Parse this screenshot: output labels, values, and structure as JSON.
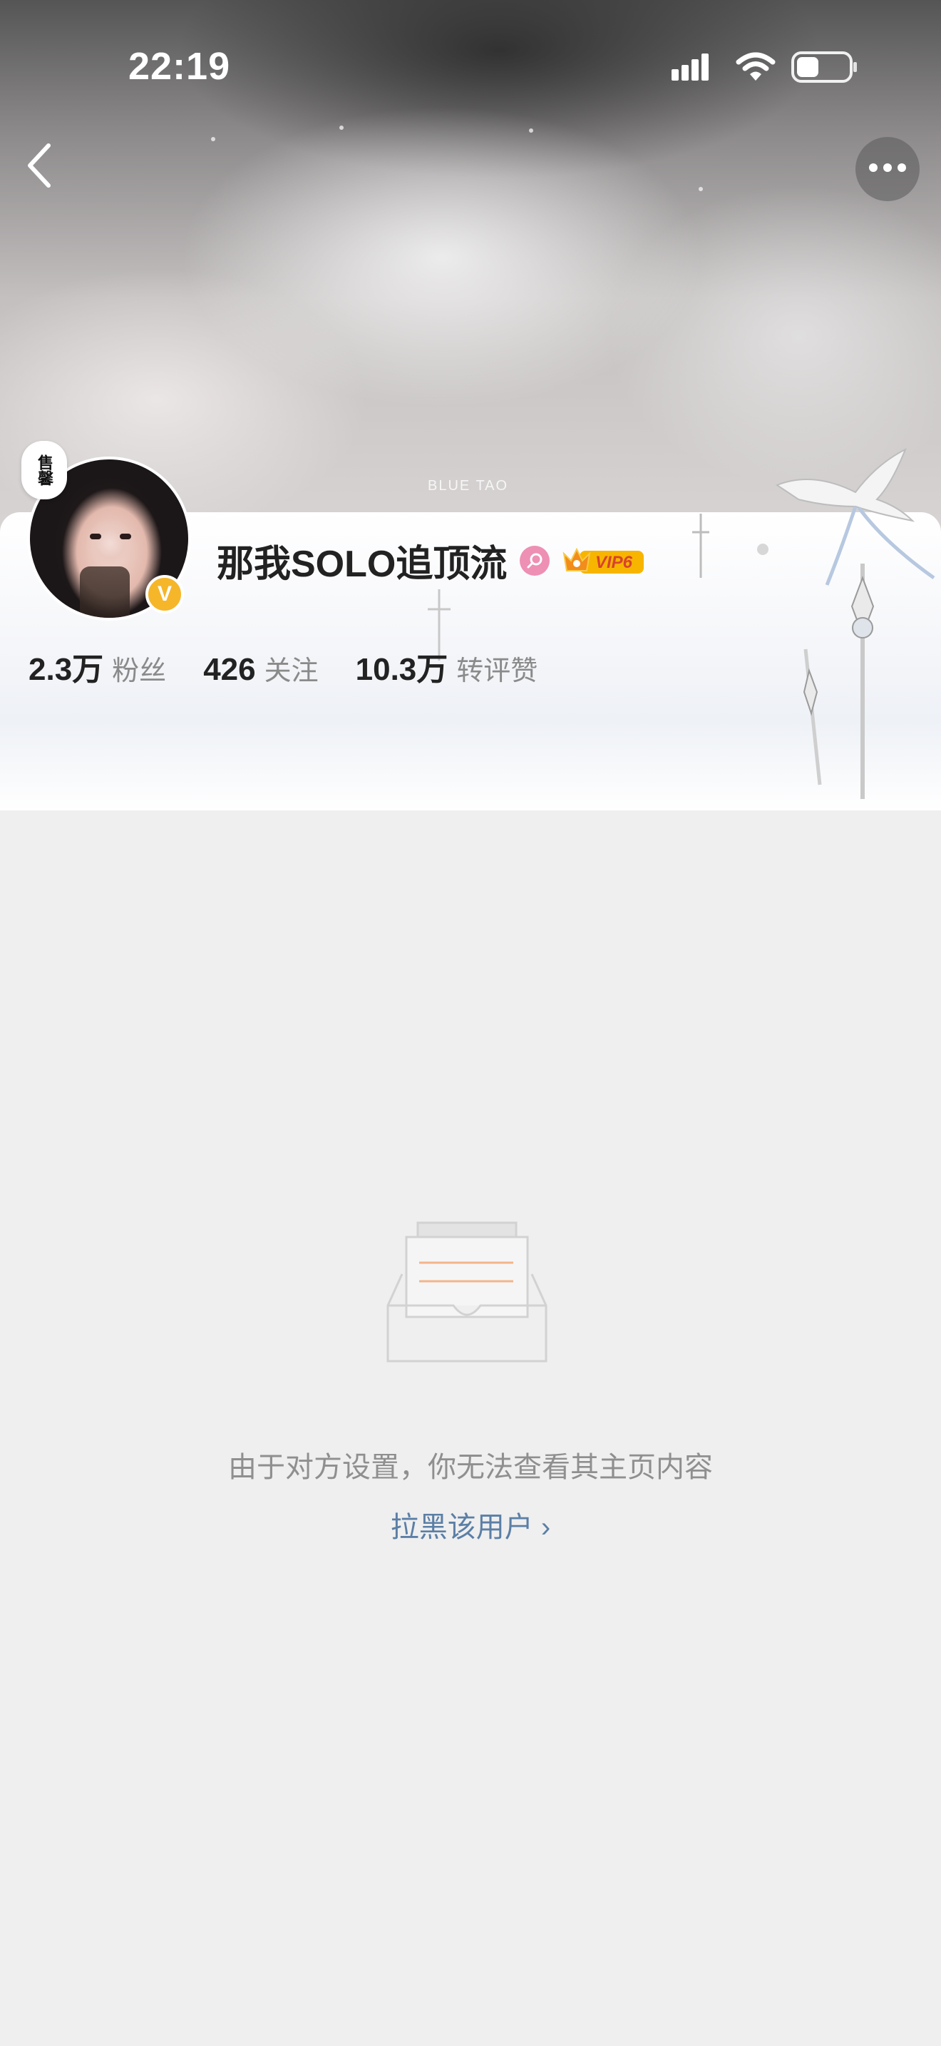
{
  "status_bar": {
    "time": "22:19"
  },
  "banner": {
    "caption": "BLUE TAO"
  },
  "profile": {
    "tag": "售馨",
    "username": "那我SOLO追顶流",
    "verified_badge": "V",
    "vip_label": "VIP6",
    "stats": [
      {
        "value": "2.3万",
        "label": "粉丝"
      },
      {
        "value": "426",
        "label": "关注"
      },
      {
        "value": "10.3万",
        "label": "转评赞"
      }
    ]
  },
  "empty_state": {
    "message": "由于对方设置，你无法查看其主页内容",
    "block_link": "拉黑该用户 ›"
  },
  "colors": {
    "page_bg": "#efefef",
    "link": "#5b7fa6",
    "verified": "#f5b62a",
    "gender": "#ee8fb4"
  },
  "icons": {
    "back": "chevron-left-icon",
    "more": "more-horizontal-icon",
    "signal": "signal-icon",
    "wifi": "wifi-icon",
    "battery": "battery-icon",
    "gender": "female-icon",
    "vip": "crown-icon"
  }
}
